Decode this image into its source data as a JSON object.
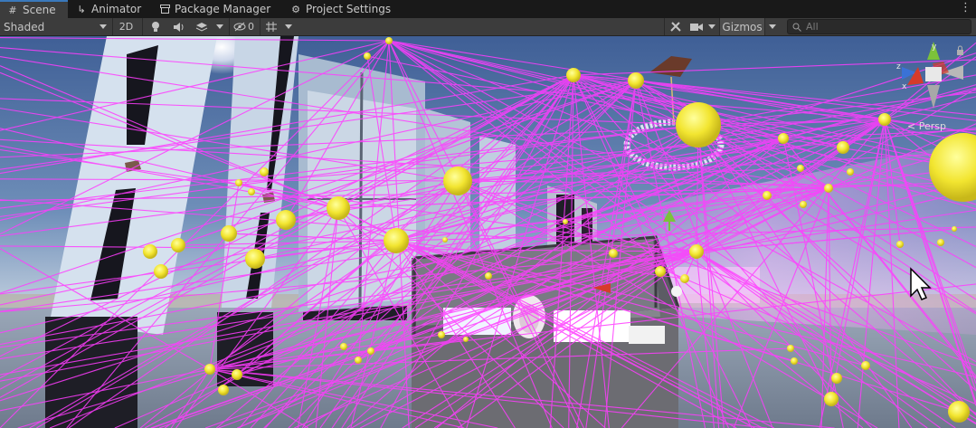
{
  "tabs": [
    {
      "label": "Scene",
      "icon": "grid-icon",
      "active": true
    },
    {
      "label": "Animator",
      "icon": "animator-icon",
      "active": false
    },
    {
      "label": "Package Manager",
      "icon": "package-icon",
      "active": false
    },
    {
      "label": "Project Settings",
      "icon": "gear-icon",
      "active": false
    }
  ],
  "toolbar": {
    "draw_mode": "Shaded",
    "mode_2d": "2D",
    "hidden_count": "0",
    "gizmos_label": "Gizmos",
    "search_placeholder": "All"
  },
  "viewport": {
    "projection_label": "< Persp",
    "axis_labels": {
      "x": "x",
      "y": "y",
      "z": "z"
    }
  },
  "colors": {
    "tab_active_accent": "#3a79bb",
    "light_gizmo": "#f2e530",
    "light_link_lines": "#ff3cff",
    "axis_x": "#d63b2a",
    "axis_y": "#7cc23a",
    "axis_z": "#3a72d6"
  }
}
